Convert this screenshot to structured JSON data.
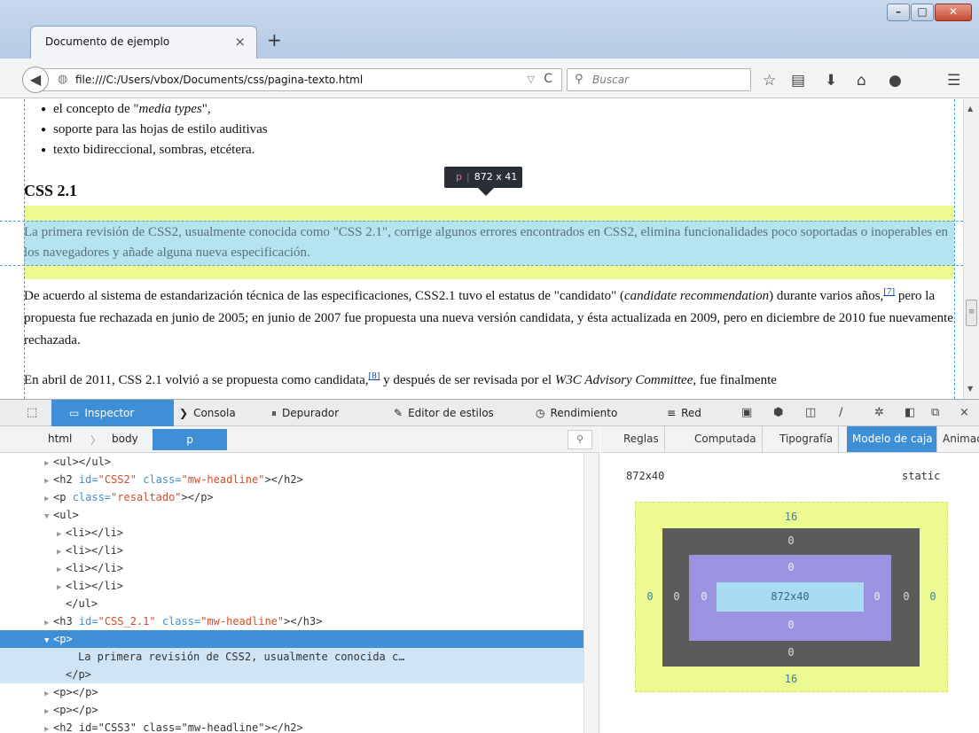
{
  "browser": {
    "tab_title": "Documento de ejemplo",
    "tab_close": "×",
    "new_tab": "+",
    "url": "file:///C:/Users/vbox/Documents/css/pagina-texto.html",
    "search_placeholder": "Buscar",
    "toolbar_icons": [
      "bookmark-star-icon",
      "reading-list-icon",
      "download-icon",
      "home-icon",
      "chat-icon",
      "menu-icon"
    ]
  },
  "page": {
    "list_items": [
      "el concepto de \"",
      "soporte para las hojas de estilo auditivas",
      "texto bidireccional, sombras, etcétera."
    ],
    "list_item_1_em": "media types",
    "list_item_1_end": "\",",
    "heading": "CSS 2.1",
    "highlighted_paragraph": "La primera revisión de CSS2, usualmente conocida como \"CSS 2.1\", corrige algunos errores encontrados en CSS2, elimina funcionalidades poco soportadas o inoperables en los navegadores y añade alguna nueva especificación.",
    "para2_a": "De acuerdo al sistema de estandarización técnica de las especificaciones, CSS2.1 tuvo el estatus de \"candidato\" (",
    "para2_em": "candidate recommendation",
    "para2_b": ") durante varios años,",
    "para2_ref": "[7]",
    "para2_c": " pero la propuesta fue rechazada en junio de 2005; en junio de 2007 fue propuesta una nueva versión candidata, y ésta actualizada en 2009, pero en diciembre de 2010 fue nuevamente rechazada.",
    "para3_a": "En abril de 2011, CSS 2.1 volvió a se propuesta como candidata,",
    "para3_ref": "[8]",
    "para3_b": " y después de ser revisada por el ",
    "para3_em": "W3C Advisory Committee",
    "para3_c": ", fue finalmente",
    "tooltip_tag": "p",
    "tooltip_size": "872 x 41"
  },
  "devtools": {
    "tabs": [
      "Inspector",
      "Consola",
      "Depurador",
      "Editor de estilos",
      "Rendimiento",
      "Red"
    ],
    "breadcrumbs": [
      "html",
      "body",
      "p"
    ],
    "side_tabs": [
      "Reglas",
      "Computada",
      "Tipografía",
      "Modelo de caja",
      "Animac"
    ],
    "markup_rows": [
      {
        "tw": "▶",
        "text": "<ul></ul>"
      },
      {
        "tw": "▶",
        "pre": "<h2 ",
        "a1n": "id=",
        "a1v": "\"CSS2\"",
        "a2n": " class=",
        "a2v": "\"mw-headline\"",
        "post": "></h2>"
      },
      {
        "tw": "▶",
        "pre": "<p ",
        "a1n": "class=",
        "a1v": "\"resaltado\"",
        "post": "></p>"
      },
      {
        "tw": "▼",
        "text": "<ul>"
      },
      {
        "tw": "▶",
        "text": "<li></li>"
      },
      {
        "tw": "▶",
        "text": "<li></li>"
      },
      {
        "tw": "▶",
        "text": "<li></li>"
      },
      {
        "tw": "▶",
        "text": "<li></li>"
      },
      {
        "tw": "",
        "text": "</ul>"
      },
      {
        "tw": "▶",
        "pre": "<h3 ",
        "a1n": "id=",
        "a1v": "\"CSS_2.1\"",
        "a2n": " class=",
        "a2v": "\"mw-headline\"",
        "post": "></h3>"
      },
      {
        "tw": "▼",
        "text": "<p>"
      },
      {
        "tw": "",
        "text": "La primera revisión de CSS2, usualmente conocida c…"
      },
      {
        "tw": "",
        "text": "</p>"
      },
      {
        "tw": "▶",
        "text": "<p></p>"
      },
      {
        "tw": "▶",
        "text": "<p></p>"
      },
      {
        "tw": "▶",
        "text": "<h2 id=\"CSS3\" class=\"mw-headline\"></h2>"
      }
    ],
    "box_model": {
      "size": "872x40",
      "position": "static",
      "margin": {
        "top": "16",
        "right": "0",
        "bottom": "16",
        "left": "0"
      },
      "border": {
        "top": "0",
        "right": "0",
        "bottom": "0",
        "left": "0"
      },
      "padding": {
        "top": "0",
        "right": "0",
        "bottom": "0",
        "left": "0"
      },
      "content": "872x40"
    }
  },
  "colors": {
    "accent": "#3e8fd6",
    "margin_highlight": "#eef990",
    "content_highlight": "#b6e3f0",
    "padding_box": "#9b93e1",
    "border_box": "#5b5b5b"
  }
}
